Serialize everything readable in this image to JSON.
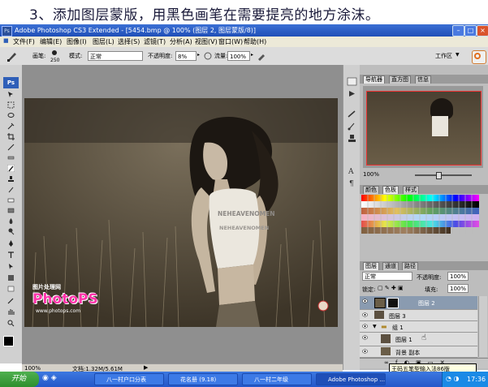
{
  "heading": "3、添加图层蒙版，用黑色画笔在需要提亮的地方涂沫。",
  "window": {
    "title": "Adobe Photoshop CS3 Extended - [5454.bmp @ 100% (图层 2, 图层蒙版/8)]",
    "app_icon": "Ps"
  },
  "menu": [
    "文件(F)",
    "编辑(E)",
    "图像(I)",
    "图层(L)",
    "选择(S)",
    "滤镜(T)",
    "分析(A)",
    "视图(V)",
    "窗口(W)",
    "帮助(H)"
  ],
  "options": {
    "brush_label": "画笔:",
    "brush_size": "250",
    "mode_label": "模式:",
    "mode_value": "正常",
    "opacity_label": "不透明度:",
    "opacity_value": "8%",
    "flow_label": "流量:",
    "flow_value": "100%",
    "workspace_label": "工作区"
  },
  "toolbox": {
    "logo": "Ps"
  },
  "document": {
    "shirt_text": "NEHEAVENOMEN",
    "watermark_top": "图片处理网",
    "watermark_brand": "PhotoPS",
    "watermark_url": "www.photops.com"
  },
  "status": {
    "zoom": "100%",
    "doc_size": "文档:1.32M/5.61M"
  },
  "navigator": {
    "tabs": [
      "导航器",
      "直方图",
      "信息"
    ],
    "zoom": "100%"
  },
  "swatches": {
    "tabs": [
      "颜色",
      "色板",
      "样式"
    ]
  },
  "layers": {
    "tabs": [
      "图层",
      "通道",
      "路径"
    ],
    "blend_mode": "正常",
    "opacity_label": "不透明度:",
    "opacity_value": "100%",
    "lock_label": "锁定:",
    "fill_label": "填充:",
    "fill_value": "100%",
    "rows": [
      {
        "name": "图层 2",
        "selected": true
      },
      {
        "name": "图层 3",
        "selected": false
      },
      {
        "name": "组 1",
        "selected": false
      },
      {
        "name": "图层 1",
        "selected": false
      },
      {
        "name": "背景 副本",
        "selected": false
      }
    ]
  },
  "taskbar": {
    "start": "开始",
    "items": [
      "八一村户口分表",
      "花名册 (9.18)",
      "八一村二年级",
      "Adobe Photoshop ..."
    ],
    "clock": "17:36",
    "ime_tip": "王码五笔型输入法86版"
  },
  "colors": {
    "titlebar": "#2a5bc8",
    "taskbar": "#2f66d6",
    "selected_layer": "#8a9bb0"
  }
}
